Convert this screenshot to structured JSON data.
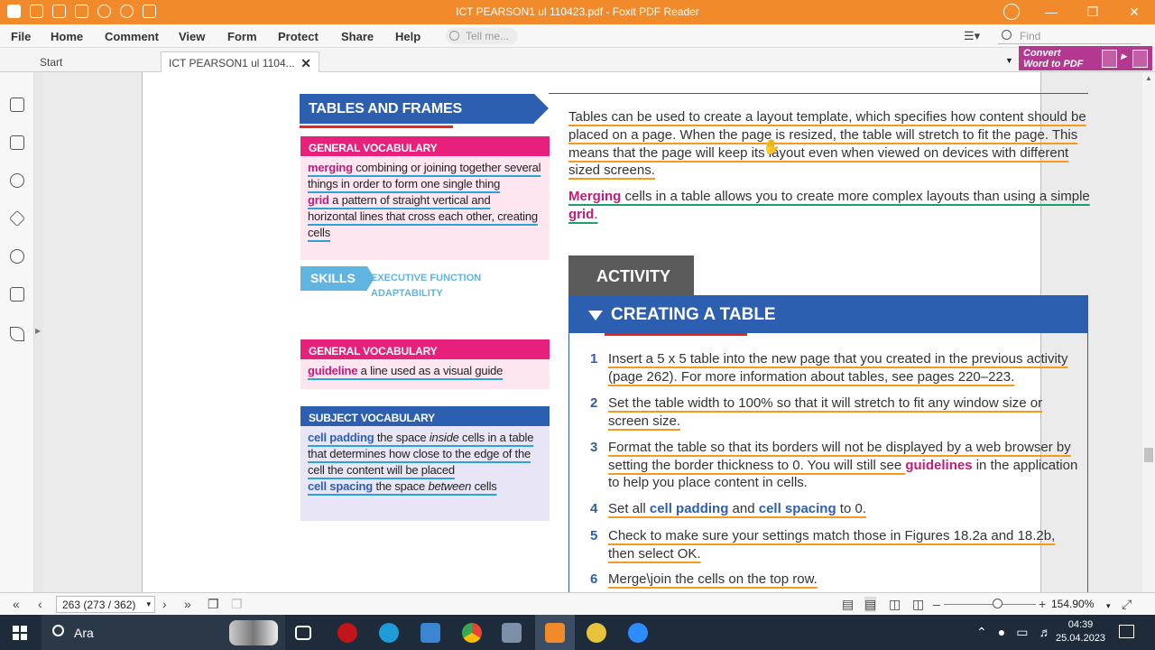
{
  "app": {
    "title": "ICT PEARSON1 ul 110423.pdf - Foxit PDF Reader",
    "tell_me": "Tell me...",
    "find": "Find"
  },
  "menu": [
    "File",
    "Home",
    "Comment",
    "View",
    "Form",
    "Protect",
    "Share",
    "Help"
  ],
  "tabs": {
    "start": "Start",
    "doc": "ICT PEARSON1 ul 1104..."
  },
  "convert": {
    "line1": "Convert",
    "line2": "Word to PDF"
  },
  "pdf": {
    "banner": "TABLES AND FRAMES",
    "vocab1": {
      "header": "GENERAL VOCABULARY",
      "t1": "merging",
      "d1": " combining or joining together several things in order to form one single thing",
      "t2": "grid",
      "d2": " a pattern of straight vertical and horizontal lines that cross each other, creating cells"
    },
    "skills": {
      "label": "SKILLS",
      "line1": "EXECUTIVE FUNCTION",
      "line2": "ADAPTABILITY"
    },
    "vocab2": {
      "header": "GENERAL VOCABULARY",
      "t1": "guideline",
      "d1": " a line used as a visual guide"
    },
    "vocab3": {
      "header": "SUBJECT VOCABULARY",
      "t1": "cell padding",
      "d1a": " the space ",
      "d1i": "inside",
      "d1b": " cells in a table that determines how close to the edge of the cell the content will be placed",
      "t2": "cell spacing",
      "d2a": " the space ",
      "d2i": "between",
      "d2b": " cells"
    },
    "para1": "Tables can be used to create a layout template, which specifies how content should be placed on a page. When the page is resized, the table will stretch to fit the page. This means that the page will keep its layout even when viewed on devices with different sized screens.",
    "para2": {
      "term1": "Merging",
      "mid": " cells in a table allows you to create more complex layouts than using a simple ",
      "term2": "grid",
      "end": "."
    },
    "activity": {
      "tab": "ACTIVITY",
      "header": "CREATING A TABLE",
      "steps": [
        {
          "n": "1",
          "text": "Insert a 5 x 5 table into the new page that you created in the previous activity (page 262). For more information about tables, see pages 220–223."
        },
        {
          "n": "2",
          "text": "Set the table width to 100% so that it will stretch to fit any window size or screen size."
        },
        {
          "n": "3",
          "a": "Format the table so that its borders will not be displayed by a web browser by setting the border thickness to 0. You will still see ",
          "term": "guidelines",
          "b": " in the application to help you place content in cells."
        },
        {
          "n": "4",
          "a": "Set all ",
          "t1": "cell padding",
          "m": " and ",
          "t2": "cell spacing",
          "b": " to 0."
        },
        {
          "n": "5",
          "text": "Check to make sure your settings match those in Figures 18.2a and 18.2b, then select OK."
        },
        {
          "n": "6",
          "text": "Merge\\join the cells on the top row."
        }
      ]
    }
  },
  "status": {
    "page": "263 (273 / 362)",
    "zoom": "154.90%"
  },
  "taskbar": {
    "search": "Ara",
    "time": "04:39",
    "date": "25.04.2023"
  },
  "colors": {
    "titlebar": "#f08a2a",
    "accent_blue": "#2d5fb0",
    "magenta": "#e6207b",
    "highlight_orange": "#f59a1f",
    "highlight_green": "#1aa06a",
    "highlight_blue": "#29a3d8"
  }
}
